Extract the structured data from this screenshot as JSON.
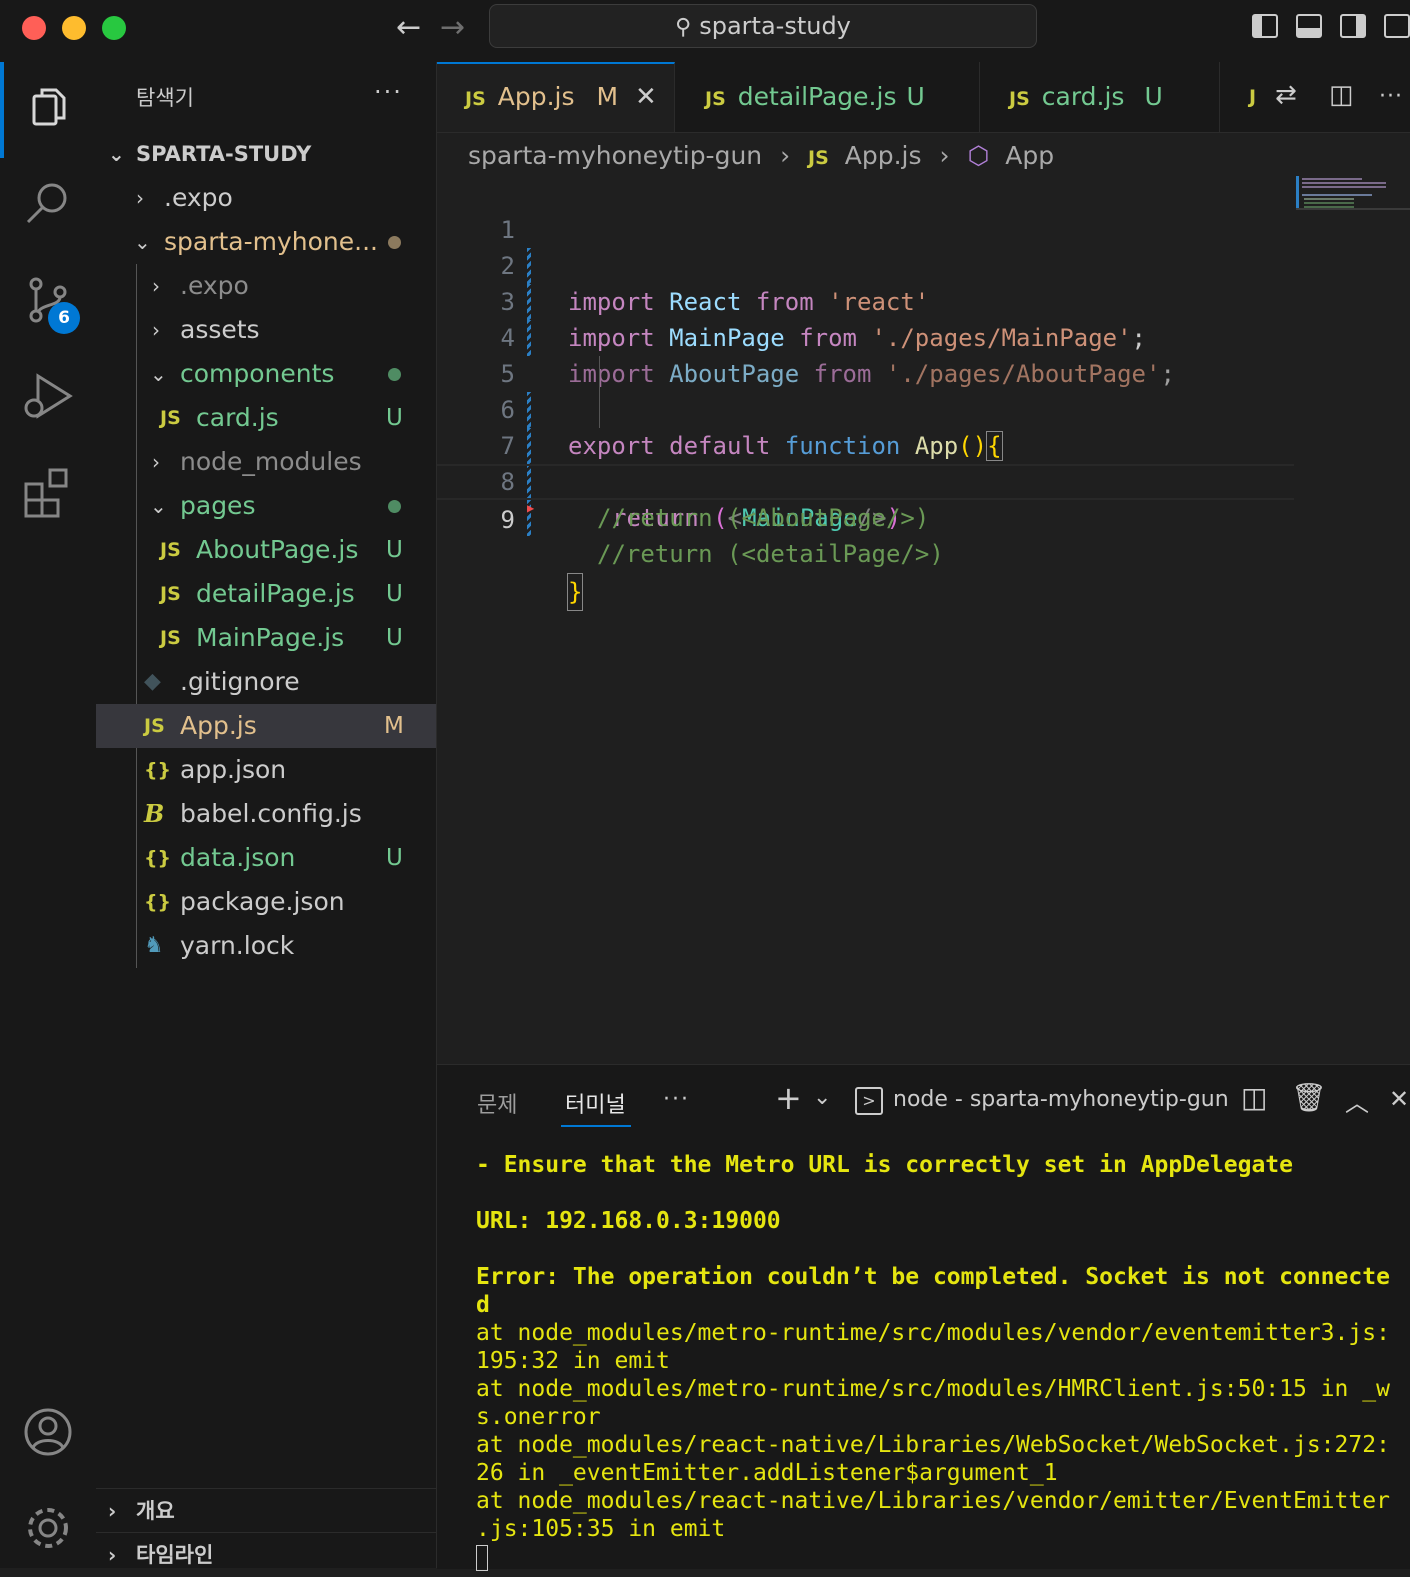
{
  "titlebar": {
    "search_text": "sparta-study"
  },
  "activity": {
    "scm_badge": "6"
  },
  "sidebar": {
    "title": "탐색기",
    "more": "···",
    "root": "SPARTA-STUDY",
    "items": [
      {
        "name": ".expo",
        "status": "",
        "color": "#cccccc"
      },
      {
        "name": "sparta-myhone...",
        "status": "",
        "color": "#e2c08d"
      },
      {
        "name": ".expo",
        "status": "",
        "color": "#8c8c8c"
      },
      {
        "name": "assets",
        "status": "",
        "color": "#cccccc"
      },
      {
        "name": "components",
        "status": "",
        "color": "#73c991"
      },
      {
        "name": "card.js",
        "status": "U",
        "color": "#73c991"
      },
      {
        "name": "node_modules",
        "status": "",
        "color": "#8c8c8c"
      },
      {
        "name": "pages",
        "status": "",
        "color": "#73c991"
      },
      {
        "name": "AboutPage.js",
        "status": "U",
        "color": "#73c991"
      },
      {
        "name": "detailPage.js",
        "status": "U",
        "color": "#73c991"
      },
      {
        "name": "MainPage.js",
        "status": "U",
        "color": "#73c991"
      },
      {
        "name": ".gitignore",
        "status": "",
        "color": "#cccccc"
      },
      {
        "name": "App.js",
        "status": "M",
        "color": "#e2c08d"
      },
      {
        "name": "app.json",
        "status": "",
        "color": "#cccccc"
      },
      {
        "name": "babel.config.js",
        "status": "",
        "color": "#cccccc"
      },
      {
        "name": "data.json",
        "status": "U",
        "color": "#73c991"
      },
      {
        "name": "package.json",
        "status": "",
        "color": "#cccccc"
      },
      {
        "name": "yarn.lock",
        "status": "",
        "color": "#cccccc"
      }
    ],
    "icons": {
      "js": "JS",
      "json": "{}"
    },
    "sections": [
      "개요",
      "타임라인"
    ]
  },
  "tabs": [
    {
      "icon": "JS",
      "label": "App.js",
      "status": "M"
    },
    {
      "icon": "JS",
      "label": "detailPage.js",
      "status": "U"
    },
    {
      "icon": "JS",
      "label": "card.js",
      "status": "U"
    },
    {
      "icon": "J",
      "label": "",
      "status": ""
    }
  ],
  "breadcrumb": {
    "folder": "sparta-myhoneytip-gun",
    "file_icon": "JS",
    "file": "App.js",
    "symbol": "App"
  },
  "editor": {
    "line_numbers": [
      "1",
      "2",
      "3",
      "4",
      "5",
      "6",
      "7",
      "8",
      "9"
    ],
    "lines": {
      "l1": [
        "import",
        "React",
        "from",
        "'react'"
      ],
      "l2": [
        "import",
        "MainPage",
        "from",
        "'./pages/MainPage'",
        ";"
      ],
      "l3": [
        "import",
        "AboutPage",
        "from",
        "'./pages/AboutPage'",
        ";"
      ],
      "l5": [
        "export",
        "default",
        "function",
        "App",
        "(",
        ")",
        "{"
      ],
      "l6": [
        "return",
        "(",
        "<",
        "MainPage",
        "/>",
        ")"
      ],
      "l7": "//return (<AboutPage/>)",
      "l8": "//return (<detailPage/>)",
      "l9": "}"
    }
  },
  "panel": {
    "tabs": [
      "문제",
      "터미널"
    ],
    "more": "···",
    "terminal_name": "node - sparta-myhoneytip-gun",
    "terminal_lines": [
      "- Ensure that the Metro URL is correctly set in AppDelegate",
      "",
      "URL: 192.168.0.3:19000",
      "",
      "Error: The operation couldn’t be completed. Socket is not connecte",
      "d",
      "at node_modules/metro-runtime/src/modules/vendor/eventemitter3.js:",
      "195:32 in emit",
      "at node_modules/metro-runtime/src/modules/HMRClient.js:50:15 in _w",
      "s.onerror",
      "at node_modules/react-native/Libraries/WebSocket/WebSocket.js:272:",
      "26 in _eventEmitter.addListener$argument_1",
      "at node_modules/react-native/Libraries/vendor/emitter/EventEmitter",
      ".js:105:35 in emit"
    ]
  },
  "colors": {
    "accent": "#0078d4",
    "modified": "#e2c08d",
    "untracked": "#73c991",
    "terminal_text": "#e5e510"
  }
}
